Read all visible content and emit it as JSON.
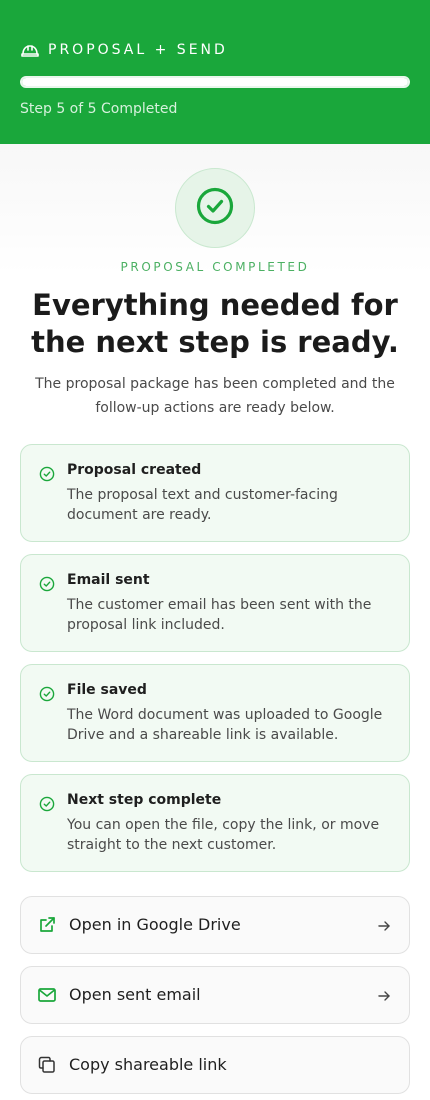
{
  "header": {
    "icon": "hard-hat-icon",
    "title": "PROPOSAL + SEND",
    "progress": 1.0,
    "step_text": "Step 5 of 5 Completed"
  },
  "hero": {
    "icon": "check-circle-icon",
    "eyebrow": "PROPOSAL COMPLETED",
    "headline": "Everything needed for the next step is ready.",
    "subtext": "The proposal package has been completed and the follow-up actions are ready below."
  },
  "status_cards": [
    {
      "icon": "check-circle-icon",
      "title": "Proposal created",
      "description": "The proposal text and customer-facing document are ready."
    },
    {
      "icon": "check-circle-icon",
      "title": "Email sent",
      "description": "The customer email has been sent with the proposal link included."
    },
    {
      "icon": "check-circle-icon",
      "title": "File saved",
      "description": "The Word document was uploaded to Google Drive and a shareable link is available."
    },
    {
      "icon": "check-circle-icon",
      "title": "Next step complete",
      "description": "You can open the file, copy the link, or move straight to the next customer."
    }
  ],
  "actions": [
    {
      "icon": "external-link-icon",
      "label": "Open in Google Drive",
      "trailing_icon": "arrow-right-icon"
    },
    {
      "icon": "mail-icon",
      "label": "Open sent email",
      "trailing_icon": "arrow-right-icon"
    },
    {
      "icon": "copy-icon",
      "label": "Copy shareable link"
    }
  ],
  "colors": {
    "brand_green": "#1aa73b",
    "accent_green": "#4cb063",
    "card_bg": "#f2faf3",
    "card_border": "#c9e7cf"
  }
}
